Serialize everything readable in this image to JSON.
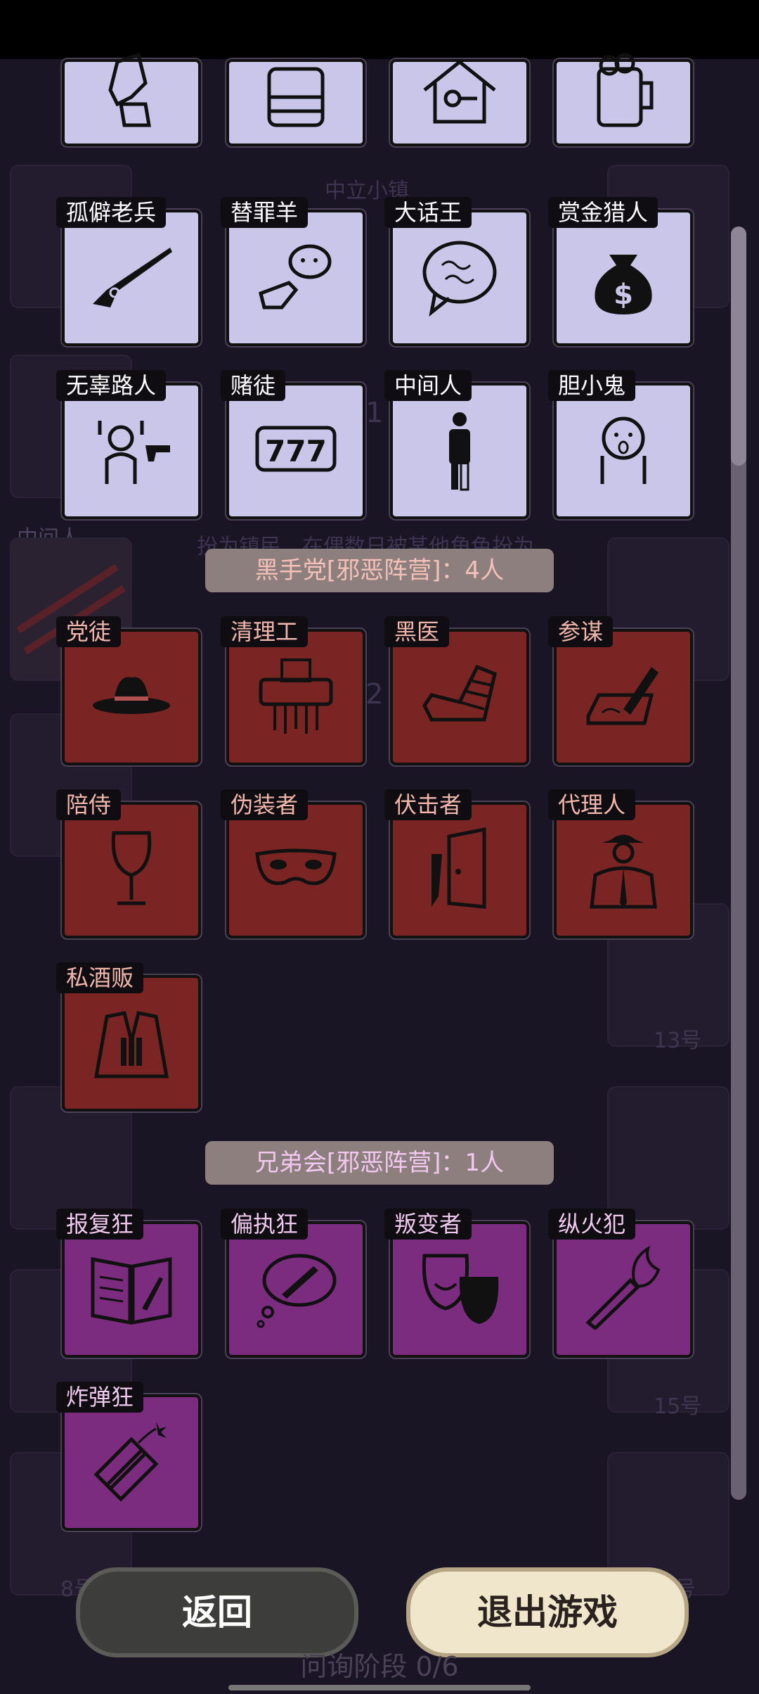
{
  "roles_top_partial": [
    {
      "icon": "fist-cash-icon"
    },
    {
      "icon": "bulletproof-vest-icon"
    },
    {
      "icon": "house-key-icon"
    },
    {
      "icon": "beer-mug-icon"
    }
  ],
  "neutral_roles": [
    {
      "name": "孤僻老兵",
      "icon": "rifle-icon"
    },
    {
      "name": "替罪羊",
      "icon": "sheep-pointing-icon"
    },
    {
      "name": "大话王",
      "icon": "speech-bubble-icon"
    },
    {
      "name": "赏金猎人",
      "icon": "money-bag-icon"
    },
    {
      "name": "无辜路人",
      "icon": "hands-up-gun-icon"
    },
    {
      "name": "赌徒",
      "icon": "slot-777-icon"
    },
    {
      "name": "中间人",
      "icon": "half-person-icon"
    },
    {
      "name": "胆小鬼",
      "icon": "scared-face-icon"
    }
  ],
  "mafia_section": {
    "title": "黑手党[邪恶阵营]：4人",
    "roles": [
      {
        "name": "党徒",
        "icon": "fedora-icon"
      },
      {
        "name": "清理工",
        "icon": "shredder-icon"
      },
      {
        "name": "黑医",
        "icon": "bandaged-arm-icon"
      },
      {
        "name": "参谋",
        "icon": "pen-writing-icon"
      },
      {
        "name": "陪侍",
        "icon": "wine-glass-icon"
      },
      {
        "name": "伪装者",
        "icon": "mask-icon"
      },
      {
        "name": "伏击者",
        "icon": "knife-door-icon"
      },
      {
        "name": "代理人",
        "icon": "suit-man-icon"
      },
      {
        "name": "私酒贩",
        "icon": "bottles-coat-icon"
      }
    ]
  },
  "brother_section": {
    "title": "兄弟会[邪恶阵营]：1人",
    "roles": [
      {
        "name": "报复狂",
        "icon": "book-knife-icon"
      },
      {
        "name": "偏执狂",
        "icon": "thought-knife-icon"
      },
      {
        "name": "叛变者",
        "icon": "theater-masks-icon"
      },
      {
        "name": "纵火犯",
        "icon": "torch-icon"
      },
      {
        "name": "炸弹狂",
        "icon": "dynamite-icon"
      }
    ]
  },
  "background": {
    "town_label": "中立小镇",
    "middleman_label": "中间人",
    "desc_fragment": "扮为镇民，在偶数日被某他角色扮为",
    "number_1": "1",
    "number_2": "2",
    "seat_13": "13号",
    "seat_15": "15号",
    "seat_8": "8号",
    "seat_right": "号"
  },
  "buttons": {
    "back": "返回",
    "exit": "退出游戏"
  },
  "phase_text": "问询阶段 0/6",
  "colors": {
    "neutral": "#c9c6ea",
    "mafia": "#7a2424",
    "brother": "#7c2c7e"
  }
}
